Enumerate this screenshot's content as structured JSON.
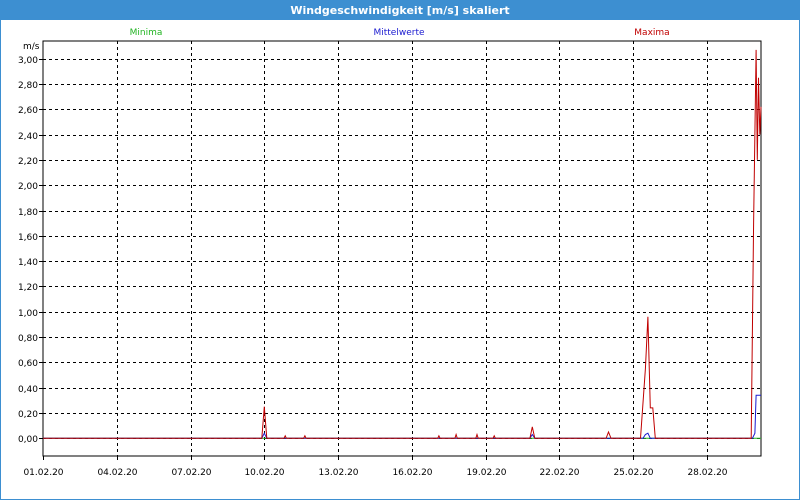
{
  "window": {
    "title": "Windgeschwindigkeit [m/s] skaliert"
  },
  "colors": {
    "titlebar": "#3d8fd1",
    "minima": "#22b422",
    "mittelwerte": "#1a1ad0",
    "maxima": "#c00000"
  },
  "chart_data": {
    "type": "line",
    "ylabel": "m/s",
    "ylim": [
      -0.14,
      3.14
    ],
    "yticks": [
      0,
      0.2,
      0.4,
      0.6,
      0.8,
      1.0,
      1.2,
      1.4,
      1.6,
      1.8,
      2.0,
      2.2,
      2.4,
      2.6,
      2.8,
      3.0
    ],
    "ytick_labels": [
      "0,00",
      "0,20",
      "0,40",
      "0,60",
      "0,80",
      "1,00",
      "1,20",
      "1,40",
      "1,60",
      "1,80",
      "2,00",
      "2,20",
      "2,40",
      "2,60",
      "2,80",
      "3,00"
    ],
    "xlim": [
      1,
      30.2
    ],
    "xticks": [
      1,
      4,
      7,
      10,
      13,
      16,
      19,
      22,
      25,
      28
    ],
    "xtick_labels": [
      "01.02.20",
      "04.02.20",
      "07.02.20",
      "10.02.20",
      "13.02.20",
      "16.02.20",
      "19.02.20",
      "22.02.20",
      "25.02.20",
      "28.02.20"
    ],
    "grid": true,
    "legend": "top",
    "series": [
      {
        "name": "Minima",
        "x": [
          1,
          30.2
        ],
        "y": [
          0,
          0
        ]
      },
      {
        "name": "Mittelwerte",
        "x": [
          1,
          9.9,
          10.0,
          10.1,
          20.8,
          20.9,
          21.0,
          24.2,
          25.4,
          25.5,
          25.6,
          25.7,
          29.85,
          29.95,
          30.0,
          30.1,
          30.2
        ],
        "y": [
          0,
          0,
          0.04,
          0,
          0,
          0.03,
          0,
          0,
          0,
          0.03,
          0.04,
          0,
          0,
          0.04,
          0.34,
          0.34,
          0.34
        ]
      },
      {
        "name": "Maxima",
        "x": [
          1,
          9.9,
          10.0,
          10.1,
          10.8,
          10.85,
          10.9,
          11.6,
          11.65,
          11.7,
          17.05,
          17.1,
          17.15,
          17.75,
          17.8,
          17.85,
          18.6,
          18.65,
          18.7,
          19.3,
          19.35,
          19.4,
          20.8,
          20.9,
          21.0,
          23.9,
          24.0,
          24.1,
          25.3,
          25.5,
          25.6,
          25.7,
          25.8,
          25.9,
          29.8,
          29.9,
          30.0,
          30.05,
          30.1,
          30.15,
          30.2
        ],
        "y": [
          0,
          0,
          0.25,
          0,
          0,
          0.02,
          0,
          0,
          0.02,
          0,
          0,
          0.02,
          0,
          0,
          0.03,
          0,
          0,
          0.03,
          0,
          0,
          0.02,
          0,
          0,
          0.09,
          0,
          0,
          0.05,
          0,
          0,
          0.55,
          0.96,
          0.24,
          0.24,
          0,
          0,
          1.7,
          3.07,
          2.2,
          2.85,
          2.4,
          2.62
        ]
      }
    ]
  }
}
